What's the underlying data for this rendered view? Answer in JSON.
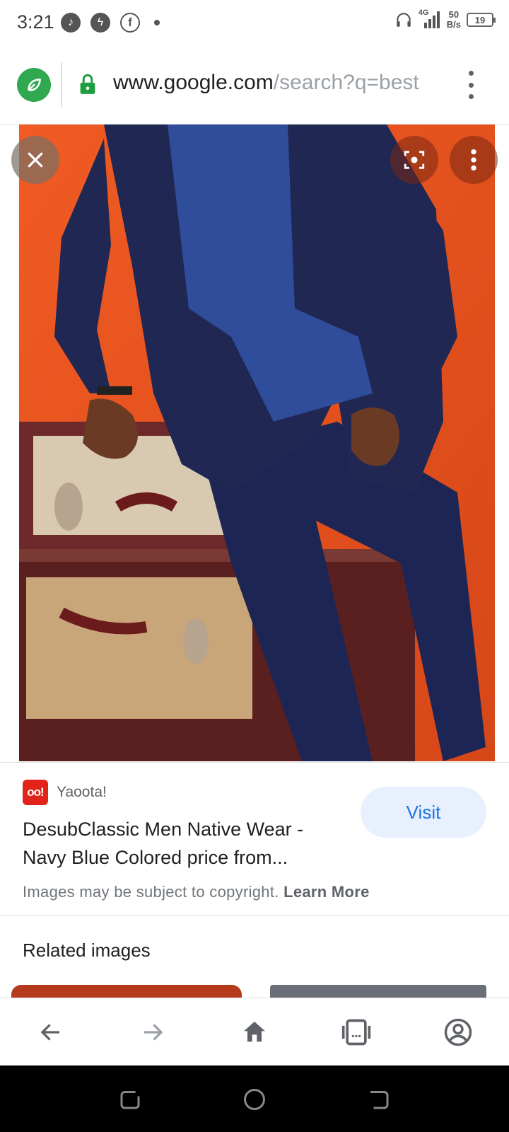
{
  "status_bar": {
    "time": "3:21",
    "icons": [
      "music-icon",
      "messenger-icon",
      "facebook-icon",
      "dot-icon"
    ],
    "network": "4G",
    "speed_value": "50",
    "speed_unit": "B/s",
    "battery": "19"
  },
  "url_bar": {
    "domain": "www.google.com",
    "path": "/search?q=best",
    "secure": true
  },
  "result": {
    "source_logo_text": "oo!",
    "source_name": "Yaoota!",
    "title": "DesubClassic Men Native Wear - Navy Blue Colored price from...",
    "visit_label": "Visit",
    "copyright_text": "Images may be subject to copyright.",
    "learn_more": "Learn More"
  },
  "related": {
    "title": "Related images"
  },
  "colors": {
    "accent": "#1a73e8",
    "visit_bg": "#e8f0fe",
    "photo_background": "#e8531f",
    "outfit_navy": "#1f2752",
    "site_icon": "#2fa84f",
    "source_logo": "#e2231a"
  }
}
